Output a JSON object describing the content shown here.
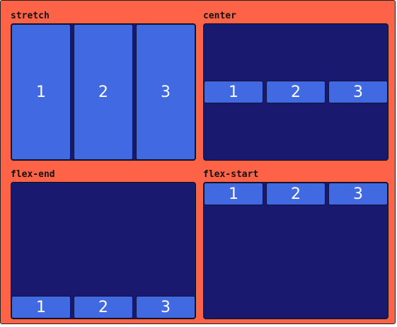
{
  "colors": {
    "container_bg": "#ff6347",
    "box_bg": "#191970",
    "item_bg": "#4169e1",
    "item_text": "#ffffff"
  },
  "panels": [
    {
      "label": "stretch",
      "items": [
        "1",
        "2",
        "3"
      ]
    },
    {
      "label": "center",
      "items": [
        "1",
        "2",
        "3"
      ]
    },
    {
      "label": "flex-end",
      "items": [
        "1",
        "2",
        "3"
      ]
    },
    {
      "label": "flex-start",
      "items": [
        "1",
        "2",
        "3"
      ]
    }
  ]
}
